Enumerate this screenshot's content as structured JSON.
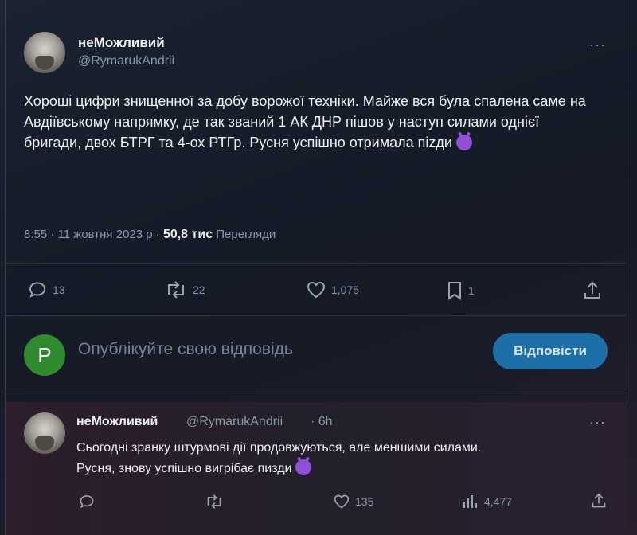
{
  "tweet": {
    "author_name": "неМожливий",
    "author_handle": "@RymarukAndrii",
    "more_label": "···",
    "text": "Хороші цифри знищенної за добу ворожої техніки. Майже вся була спалена саме на Авдіївському напрямку, де так званий 1 АК ДНР пішов у наступ силами однієї бригади, двох БТРГ та 4-ох РТГр. Русня успішно отримала пizди",
    "time": "8:55 · 11 жовтня 2023 р ·",
    "views_count": "50,8 тис",
    "views_label": "Перегляди",
    "replies": "13",
    "retweets": "22",
    "likes": "1,075",
    "bookmarks": "1"
  },
  "reply_box": {
    "avatar_letter": "P",
    "placeholder": "Опублікуйте свою відповідь",
    "button_label": "Відповісти"
  },
  "thread_reply": {
    "author_name": "неМожливий",
    "author_handle": "@RymarukAndrii",
    "time": "· 6h",
    "text_line1": "Сьогодні зранку штурмові дії продовжуються, але меншими силами.",
    "text_line2": "Русня, знову успішно вигрібає пизди",
    "likes": "135",
    "views": "4,477"
  },
  "icons": {
    "reply": "reply-icon",
    "retweet": "retweet-icon",
    "like": "heart-icon",
    "bookmark": "bookmark-icon",
    "share": "share-icon",
    "views": "views-icon",
    "emoji": "smiling-devil-emoji"
  },
  "colors": {
    "accent_button": "#1d6fa8",
    "reply_avatar": "#2e8b2e",
    "emoji": "#8f4fd6"
  }
}
